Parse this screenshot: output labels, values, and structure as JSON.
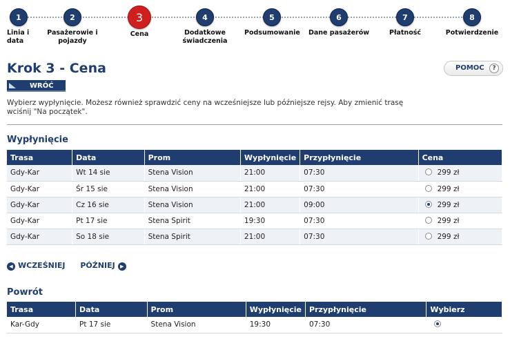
{
  "steps": [
    {
      "num": "1",
      "label_line1": "Linia i",
      "label_line2": "data"
    },
    {
      "num": "2",
      "label_line1": "Pasażerowie i",
      "label_line2": "pojazdy"
    },
    {
      "num": "3",
      "label_line1": "Cena",
      "label_line2": ""
    },
    {
      "num": "4",
      "label_line1": "Dodatkowe",
      "label_line2": "świadczenia"
    },
    {
      "num": "5",
      "label_line1": "Podsumowanie",
      "label_line2": ""
    },
    {
      "num": "6",
      "label_line1": "Dane pasażerów",
      "label_line2": ""
    },
    {
      "num": "7",
      "label_line1": "Płatność",
      "label_line2": ""
    },
    {
      "num": "8",
      "label_line1": "Potwierdzenie",
      "label_line2": ""
    }
  ],
  "active_step": "3",
  "header": {
    "title": "Krok 3 - Cena",
    "back_label": "WRÓĆ",
    "help_label": "POMOC",
    "help_icon": "?"
  },
  "intro_text": "Wybierz wypłynięcie. Możesz również sprawdzić ceny na wcześniejsze lub późniejsze rejsy. Aby zmienić trasę wciśnij \"Na początek\".",
  "outbound": {
    "section_title": "Wypłynięcie",
    "columns": [
      "Trasa",
      "Data",
      "Prom",
      "Wypłynięcie",
      "Przypłynięcie",
      "Cena"
    ],
    "rows": [
      {
        "route": "Gdy-Kar",
        "date": "Wt 14 sie",
        "ferry": "Stena Vision",
        "dep": "21:00",
        "arr": "07:30",
        "price": "299 zł",
        "selected": false
      },
      {
        "route": "Gdy-Kar",
        "date": "Śr 15 sie",
        "ferry": "Stena Vision",
        "dep": "21:00",
        "arr": "07:30",
        "price": "299 zł",
        "selected": false
      },
      {
        "route": "Gdy-Kar",
        "date": "Cz 16 sie",
        "ferry": "Stena Vision",
        "dep": "21:00",
        "arr": "09:00",
        "price": "299 zł",
        "selected": true
      },
      {
        "route": "Gdy-Kar",
        "date": "Pt 17 sie",
        "ferry": "Stena Spirit",
        "dep": "19:30",
        "arr": "07:30",
        "price": "299 zł",
        "selected": false
      },
      {
        "route": "Gdy-Kar",
        "date": "So 18 sie",
        "ferry": "Stena Spirit",
        "dep": "21:00",
        "arr": "07:30",
        "price": "299 zł",
        "selected": false
      }
    ]
  },
  "pager": {
    "earlier_label": "WCZEŚNIEJ",
    "later_label": "PÓŹNIEJ"
  },
  "return": {
    "section_title": "Powrót",
    "columns": [
      "Trasa",
      "Data",
      "Prom",
      "Wypłynięcie",
      "Przypłynięcie",
      "Wybierz"
    ],
    "rows": [
      {
        "route": "Kar-Gdy",
        "date": "Pt 17 sie",
        "ferry": "Stena Vision",
        "dep": "19:30",
        "arr": "07:30",
        "selected": true
      }
    ]
  },
  "colors": {
    "primary": "#1f3d6e",
    "active_step": "#cf1f1f",
    "row_alt": "#eef1f6"
  }
}
